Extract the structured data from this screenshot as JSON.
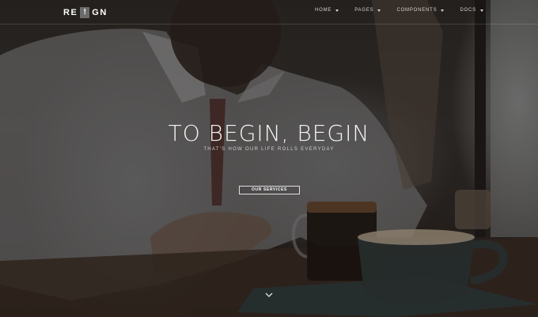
{
  "brand": {
    "logo_left": "RE",
    "logo_mark": "!",
    "logo_right": "GN"
  },
  "nav": {
    "items": [
      {
        "label": "HOME"
      },
      {
        "label": "PAGES"
      },
      {
        "label": "COMPONENTS"
      },
      {
        "label": "DOCS"
      }
    ]
  },
  "hero": {
    "title": "TO BEGIN, BEGIN",
    "subtitle": "THAT'S HOW OUR LIFE ROLLS EVERYDAY",
    "cta_label": "OUR SERVICES"
  },
  "icons": {
    "nav_caret": "chevron-down-icon",
    "scroll": "chevron-down-icon"
  }
}
